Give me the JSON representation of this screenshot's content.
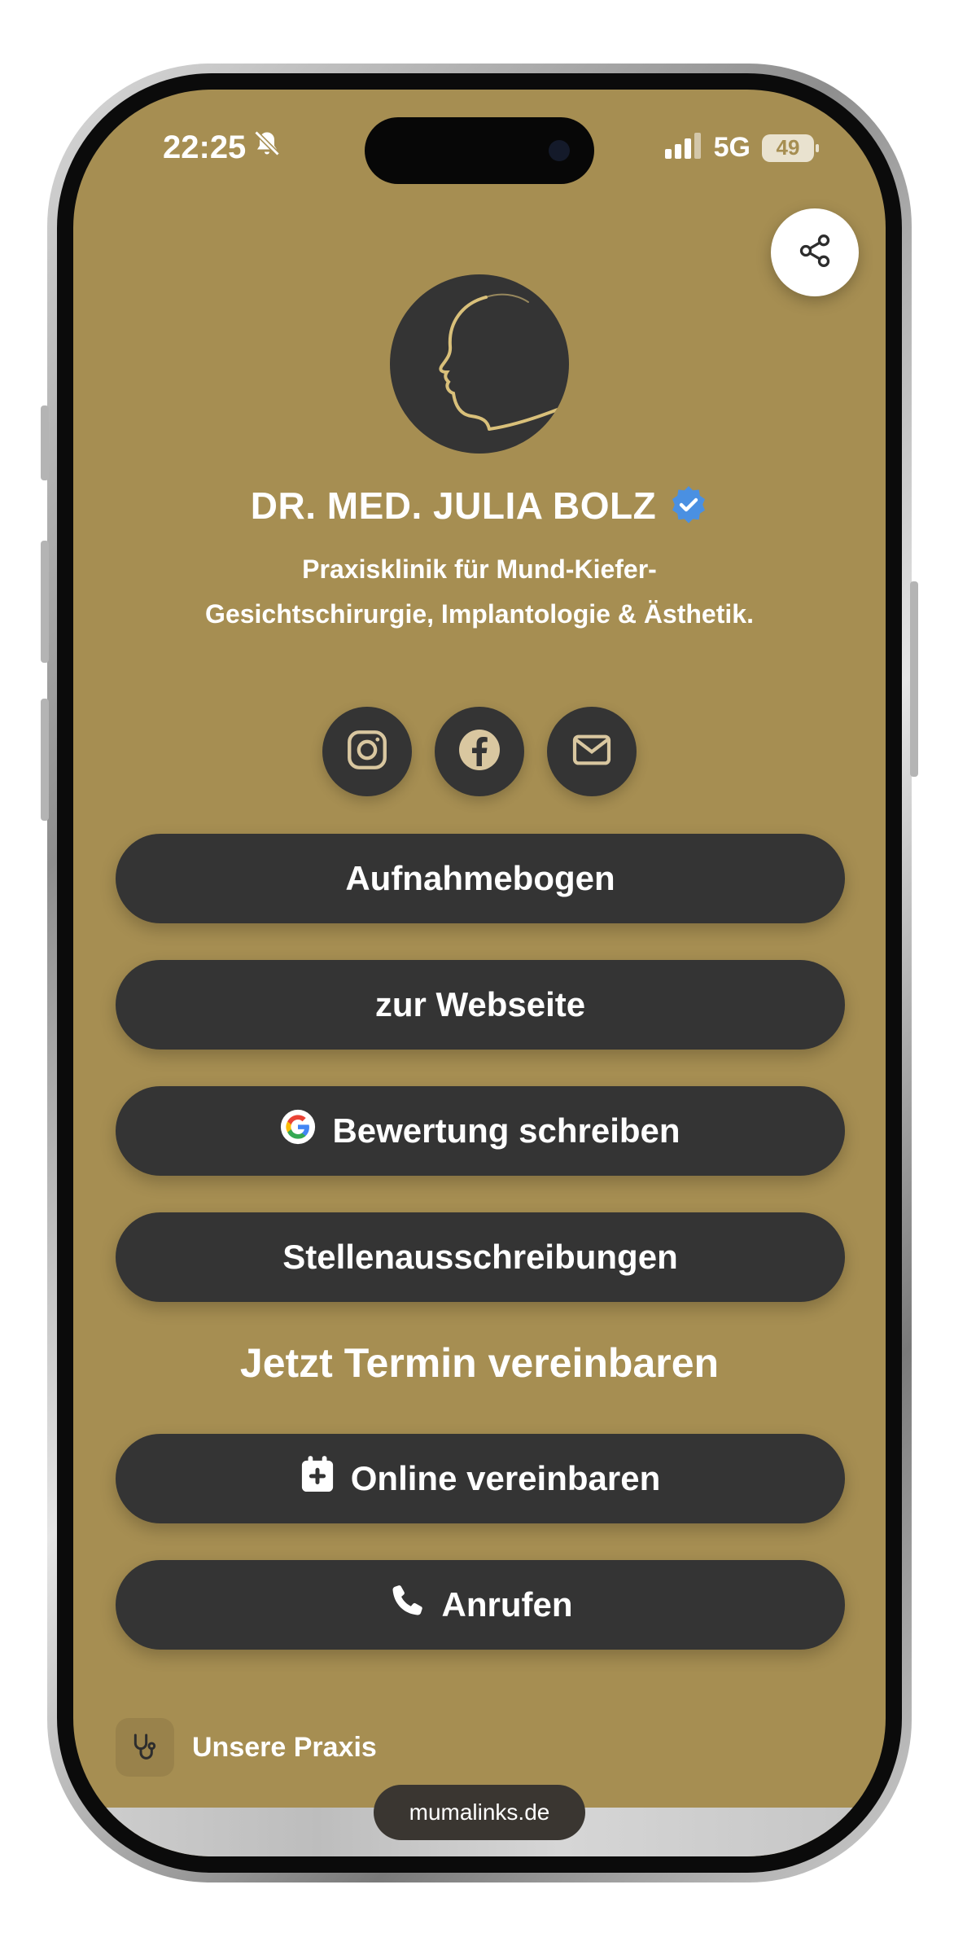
{
  "status_bar": {
    "time": "22:25",
    "network": "5G",
    "battery": "49"
  },
  "profile": {
    "name": "DR. MED. JULIA BOLZ",
    "subtitle_line1": "Praxisklinik für Mund-Kiefer-",
    "subtitle_line2": "Gesichtschirurgie, Implantologie & Ästhetik."
  },
  "social_icons": [
    "instagram-icon",
    "facebook-icon",
    "mail-icon"
  ],
  "links": {
    "aufnahmebogen": "Aufnahmebogen",
    "webseite": "zur Webseite",
    "bewertung": "Bewertung schreiben",
    "stellen": "Stellenausschreibungen"
  },
  "appointment": {
    "heading": "Jetzt Termin vereinbaren",
    "online": "Online vereinbaren",
    "call": "Anrufen"
  },
  "footer": {
    "praxis_label": "Unsere Praxis",
    "url": "mumalinks.de"
  },
  "colors": {
    "background": "#a68e52",
    "button": "#343434",
    "text": "#ffffff",
    "verified": "#4a90e2"
  }
}
